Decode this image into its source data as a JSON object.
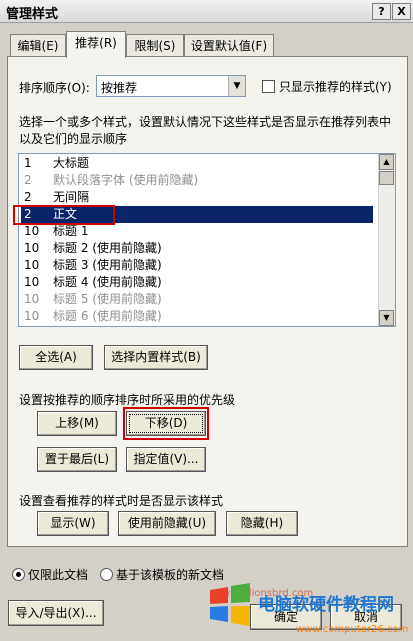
{
  "window": {
    "title": "管理样式",
    "help_label": "?",
    "close_label": "X"
  },
  "tabs": [
    {
      "label": "编辑(E)",
      "active": false
    },
    {
      "label": "推荐(R)",
      "active": true
    },
    {
      "label": "限制(S)",
      "active": false
    },
    {
      "label": "设置默认值(F)",
      "active": false
    }
  ],
  "sort": {
    "label": "排序顺序(O):",
    "value": "按推荐",
    "only_recommended_label": "只显示推荐的样式(Y)",
    "only_recommended_checked": false
  },
  "instructions": "选择一个或多个样式，设置默认情况下这些样式是否显示在推荐列表中以及它们的显示顺序",
  "style_list": [
    {
      "priority": "1",
      "name": "大标题",
      "hidden": false,
      "selected": false
    },
    {
      "priority": "2",
      "name": "默认段落字体 (使用前隐藏)",
      "hidden": true,
      "selected": false
    },
    {
      "priority": "2",
      "name": "无间隔",
      "hidden": false,
      "selected": false
    },
    {
      "priority": "2",
      "name": "正文",
      "hidden": false,
      "selected": true
    },
    {
      "priority": "10",
      "name": "标题 1",
      "hidden": false,
      "selected": false
    },
    {
      "priority": "10",
      "name": "标题 2 (使用前隐藏)",
      "hidden": false,
      "selected": false
    },
    {
      "priority": "10",
      "name": "标题 3 (使用前隐藏)",
      "hidden": false,
      "selected": false
    },
    {
      "priority": "10",
      "name": "标题 4 (使用前隐藏)",
      "hidden": false,
      "selected": false
    },
    {
      "priority": "10",
      "name": "标题 5 (使用前隐藏)",
      "hidden": true,
      "selected": false
    },
    {
      "priority": "10",
      "name": "标题 6 (使用前隐藏)",
      "hidden": true,
      "selected": false
    }
  ],
  "select_buttons": {
    "select_all": "全选(A)",
    "select_builtin": "选择内置样式(B)"
  },
  "priority_section": {
    "label": "设置按推荐的顺序排序时所采用的优先级",
    "move_up": "上移(M)",
    "move_down": "下移(D)",
    "move_to_last": "置于最后(L)",
    "assign_value": "指定值(V)..."
  },
  "visibility_section": {
    "label": "设置查看推荐的样式时是否显示该样式",
    "show": "显示(W)",
    "hide_until_used": "使用前隐藏(U)",
    "hide": "隐藏(H)"
  },
  "scope": {
    "this_document": "仅限此文档",
    "this_document_selected": true,
    "new_documents": "基于该模板的新文档",
    "new_documents_selected": false
  },
  "footer": {
    "import_export": "导入/导出(X)...",
    "ok": "确定",
    "cancel": "取消"
  },
  "watermark": {
    "site_name": "电脑软硬件教程网",
    "url": "www.computer26.com",
    "faint_url": "www.lionsbrd.com"
  },
  "colors": {
    "selection": "#0a246a",
    "highlight_box": "#d00000",
    "hidden_text": "#909090"
  }
}
